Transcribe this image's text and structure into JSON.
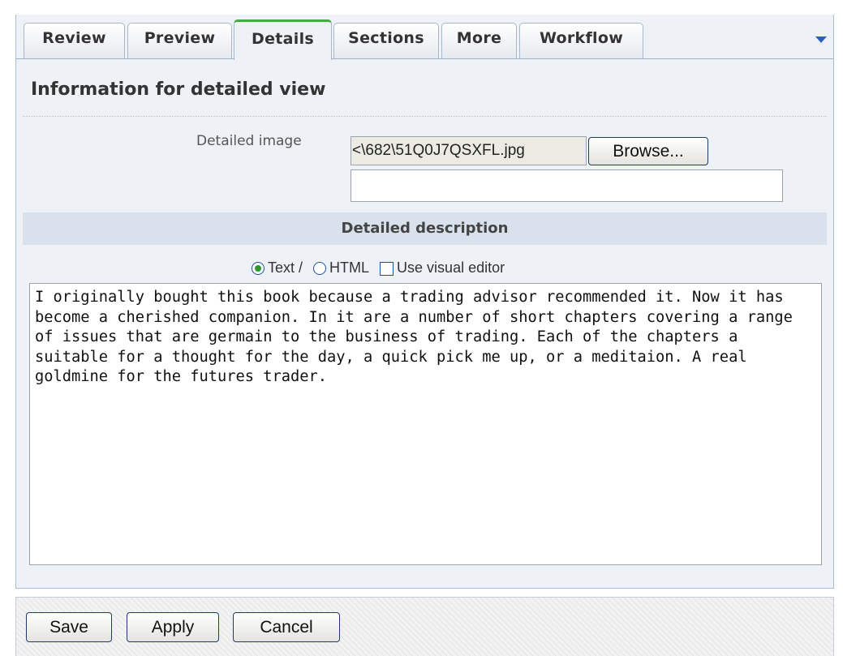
{
  "tabs": [
    {
      "label": "Review"
    },
    {
      "label": "Preview"
    },
    {
      "label": "Details"
    },
    {
      "label": "Sections"
    },
    {
      "label": "More"
    },
    {
      "label": "Workflow"
    }
  ],
  "active_tab": "Details",
  "section": {
    "heading": "Information for detailed view"
  },
  "image_field": {
    "label": "Detailed image",
    "file_value": "<\\682\\51Q0J7QSXFL.jpg",
    "browse_label": "Browse...",
    "url_value": ""
  },
  "description": {
    "header": "Detailed description",
    "mode_text": "Text /",
    "mode_html": "HTML",
    "visual_editor": "Use visual editor",
    "selected_mode": "text",
    "visual_editor_checked": false,
    "body": "I originally bought this book because a trading advisor recommended it. Now it has become a cherished companion. In it are a number of short chapters covering a range of issues that are germain to the business of trading. Each of the chapters a suitable for a thought for the day, a quick pick me up, or a meditaion. A real goldmine for the futures trader."
  },
  "buttons": {
    "save": "Save",
    "apply": "Apply",
    "cancel": "Cancel"
  },
  "colors": {
    "active_tab_accent": "#3cae3c",
    "border_blue": "#1f3a73",
    "panel_bg": "#eef2f7"
  }
}
